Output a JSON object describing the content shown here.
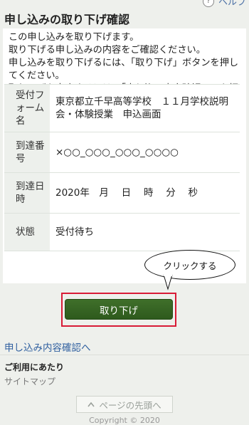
{
  "header": {
    "help_label": "ヘルプ",
    "help_icon": "?"
  },
  "page": {
    "title": "申し込みの取り下げ確認"
  },
  "intro": {
    "text": "この申し込みを取り下げます。\n取り下げる申し込みの内容をご確認ください。\n申し込みを取り下げるには、「取り下げ」ボタンを押してください。\n取り下げを中止するには、「申し込み内容確認へ」を押してください。"
  },
  "details": {
    "rows": [
      {
        "label": "受付フォーム名",
        "value": "東京都立千早高等学校　１１月学校説明会・体験授業　申込画面"
      },
      {
        "label": "到達番号",
        "value": "×○○_○○○_○○○_○○○○"
      },
      {
        "label": "到達日時",
        "value": "2020年　月　 日　  時　 分　 秒"
      },
      {
        "label": "状態",
        "value": "受付待ち"
      }
    ]
  },
  "annotation": {
    "callout_text": "クリックする",
    "highlight_color": "#d81b36"
  },
  "actions": {
    "cancel_label": "取り下げ",
    "back_link": "申し込み内容確認へ"
  },
  "footer": {
    "guide_heading": "ご利用にあたり",
    "sitemap_label": "サイトマップ",
    "page_top_label": "ページの先頭へ",
    "page_top_icon": "chevron-up-icon",
    "copyright": "Copyright © 2020"
  },
  "colors": {
    "button_green": "#3a6a25",
    "link_blue": "#2f5f9f",
    "background": "#eef0ec"
  }
}
